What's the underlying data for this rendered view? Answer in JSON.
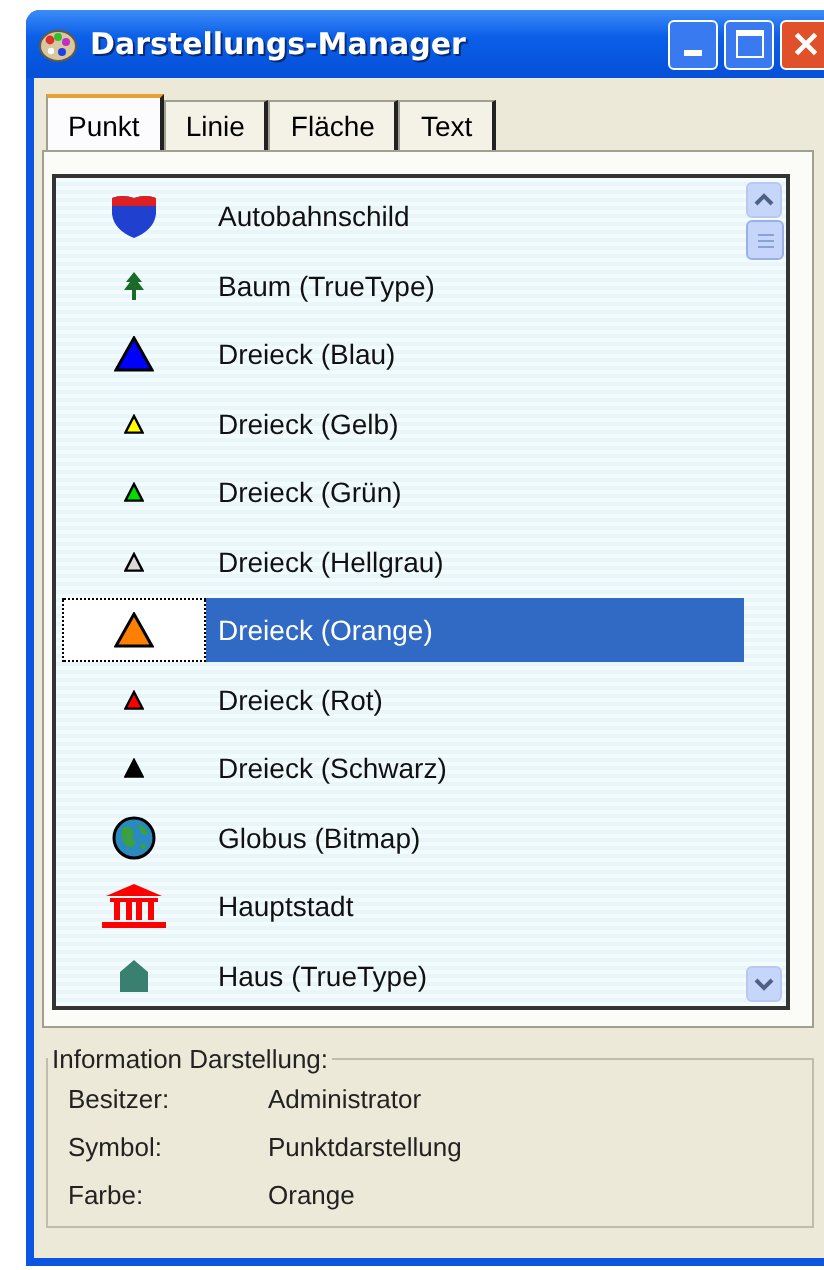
{
  "window": {
    "title": "Darstellungs-Manager"
  },
  "tabs": [
    {
      "label": "Punkt",
      "selected": true
    },
    {
      "label": "Linie",
      "selected": false
    },
    {
      "label": "Fläche",
      "selected": false
    },
    {
      "label": "Text",
      "selected": false
    }
  ],
  "symbols": [
    {
      "label": "Autobahnschild",
      "kind": "shield",
      "selected": false
    },
    {
      "label": "Baum (TrueType)",
      "kind": "tree",
      "selected": false
    },
    {
      "label": "Dreieck (Blau)",
      "kind": "triangle",
      "color": "#0000ff",
      "selected": false
    },
    {
      "label": "Dreieck (Gelb)",
      "kind": "small-triangle",
      "color": "#ffff00",
      "selected": false
    },
    {
      "label": "Dreieck (Grün)",
      "kind": "small-triangle",
      "color": "#00dd00",
      "selected": false
    },
    {
      "label": "Dreieck (Hellgrau)",
      "kind": "small-triangle",
      "color": "#d8d8d8",
      "selected": false
    },
    {
      "label": "Dreieck (Orange)",
      "kind": "triangle",
      "color": "#ff8000",
      "selected": true
    },
    {
      "label": "Dreieck (Rot)",
      "kind": "small-triangle",
      "color": "#ff0000",
      "selected": false
    },
    {
      "label": "Dreieck (Schwarz)",
      "kind": "small-triangle",
      "color": "#000000",
      "selected": false
    },
    {
      "label": "Globus (Bitmap)",
      "kind": "globe",
      "selected": false
    },
    {
      "label": "Hauptstadt",
      "kind": "capitol",
      "selected": false
    },
    {
      "label": "Haus (TrueType)",
      "kind": "house",
      "selected": false
    }
  ],
  "info": {
    "title": "Information Darstellung:",
    "fields": [
      {
        "label": "Besitzer:",
        "value": "Administrator"
      },
      {
        "label": "Symbol:",
        "value": "Punktdarstellung"
      },
      {
        "label": "Farbe:",
        "value": "Orange"
      }
    ]
  }
}
